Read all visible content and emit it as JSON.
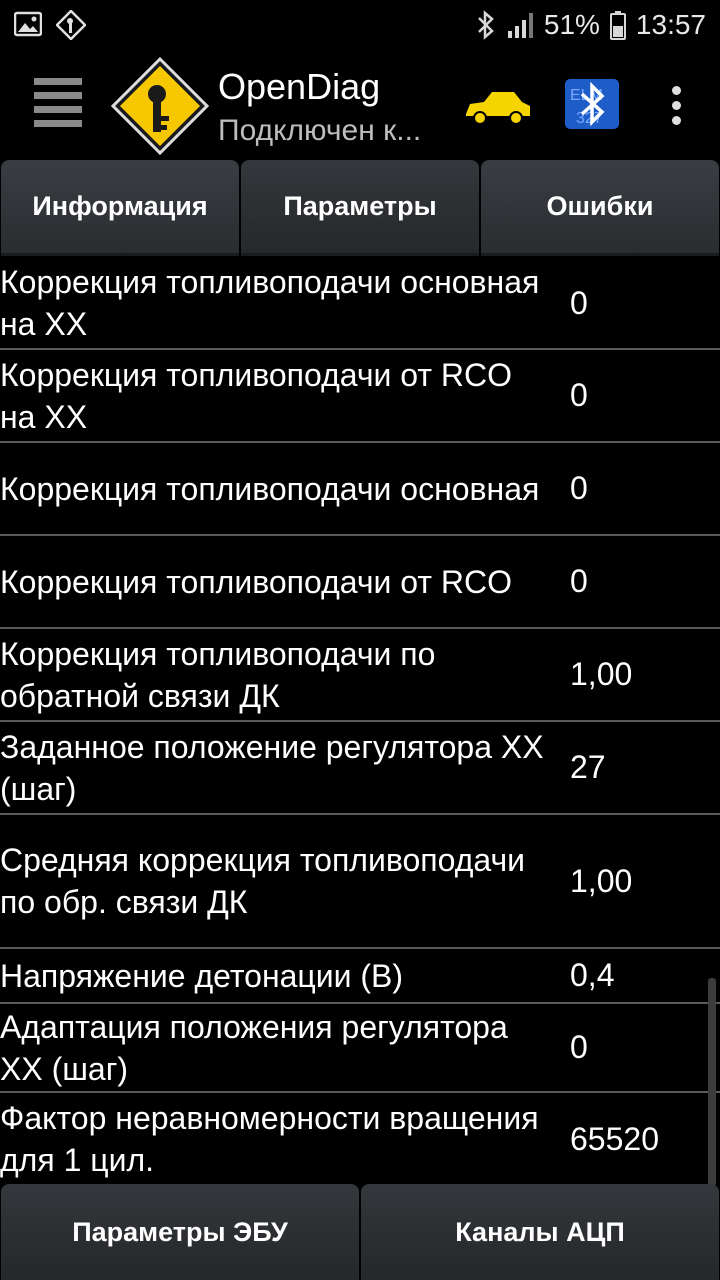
{
  "status_bar": {
    "battery": "51%",
    "time": "13:57"
  },
  "app_bar": {
    "title": "OpenDiag",
    "subtitle": "Подключен к..."
  },
  "tabs": [
    {
      "label": "Информация"
    },
    {
      "label": "Параметры"
    },
    {
      "label": "Ошибки"
    }
  ],
  "parameters": [
    {
      "name": "Коррекция топливоподачи основная на ХХ",
      "value": "0"
    },
    {
      "name": "Коррекция топливоподачи от RCO на ХХ",
      "value": "0"
    },
    {
      "name": "Коррекция топливоподачи основная",
      "value": "0"
    },
    {
      "name": "Коррекция топливоподачи от RCO",
      "value": "0"
    },
    {
      "name": "Коррекция топливоподачи по обратной связи ДК",
      "value": "1,00"
    },
    {
      "name": "Заданное положение регулятора ХХ (шаг)",
      "value": "27"
    },
    {
      "name": "Средняя коррекция топливоподачи по обр. связи ДК",
      "value": "1,00"
    },
    {
      "name": "Напряжение детонации (В)",
      "value": "0,4"
    },
    {
      "name": "Адаптация положения регулятора ХХ (шаг)",
      "value": "0"
    },
    {
      "name": "Фактор неравномерности вращения для 1 цил.",
      "value": "65520"
    }
  ],
  "bottom_buttons": [
    {
      "label": "Параметры ЭБУ"
    },
    {
      "label": "Каналы АЦП"
    }
  ],
  "colors": {
    "background": "#000000",
    "car_icon": "#f5d400",
    "logo_yellow": "#f7c800",
    "bluetooth_blue": "#1e5cc8"
  }
}
